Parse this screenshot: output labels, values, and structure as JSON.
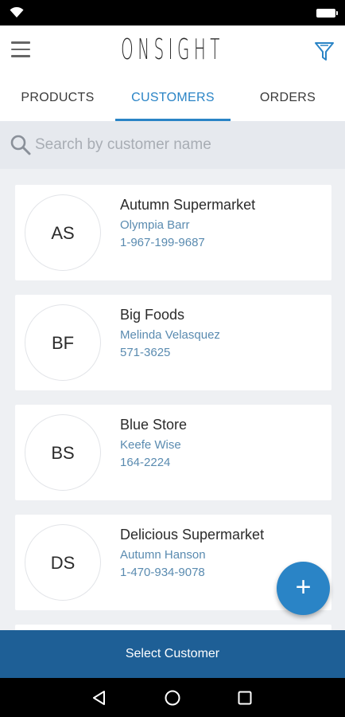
{
  "app": {
    "logo": "ONSIGHT"
  },
  "tabs": [
    {
      "label": "PRODUCTS",
      "active": false
    },
    {
      "label": "CUSTOMERS",
      "active": true
    },
    {
      "label": "ORDERS",
      "active": false
    }
  ],
  "search": {
    "placeholder": "Search by customer name",
    "value": ""
  },
  "customers": [
    {
      "initials": "AS",
      "name": "Autumn Supermarket",
      "contact": "Olympia Barr",
      "phone": "1-967-199-9687"
    },
    {
      "initials": "BF",
      "name": "Big Foods",
      "contact": "Melinda Velasquez",
      "phone": "571-3625"
    },
    {
      "initials": "BS",
      "name": "Blue Store",
      "contact": "Keefe Wise",
      "phone": "164-2224"
    },
    {
      "initials": "DS",
      "name": "Delicious Supermarket",
      "contact": "Autumn Hanson",
      "phone": "1-470-934-9078"
    }
  ],
  "fab": {
    "label": "+"
  },
  "footer": {
    "select_label": "Select Customer"
  },
  "colors": {
    "accent": "#2a84c6",
    "footer": "#1e5f96",
    "contact_text": "#5a8bb0",
    "background": "#eef0f3"
  },
  "icons": [
    "wifi-icon",
    "battery-icon",
    "menu-icon",
    "filter-icon",
    "search-icon",
    "add-icon",
    "back-icon",
    "home-icon",
    "recent-apps-icon"
  ]
}
